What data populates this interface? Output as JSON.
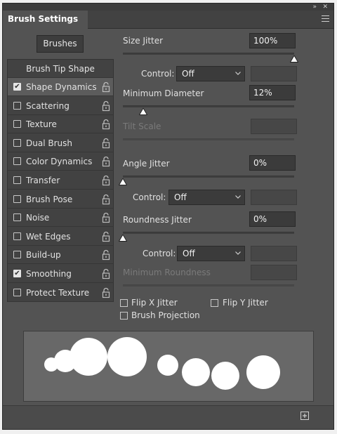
{
  "panel": {
    "title": "Brush Settings"
  },
  "icons": {
    "collapse": "double-chevron-icon",
    "close": "close-icon",
    "menu": "hamburger-menu-icon",
    "lock": "lock-icon",
    "dropdown": "chevron-down-icon",
    "slider_thumb": "triangle-thumb-icon",
    "new_preset": "new-brush-icon"
  },
  "brushes_button": "Brushes",
  "sidebar": {
    "header": "Brush Tip Shape",
    "items": [
      {
        "label": "Shape Dynamics",
        "checked": true,
        "selected": true
      },
      {
        "label": "Scattering",
        "checked": false
      },
      {
        "label": "Texture",
        "checked": false
      },
      {
        "label": "Dual Brush",
        "checked": false
      },
      {
        "label": "Color Dynamics",
        "checked": false
      },
      {
        "label": "Transfer",
        "checked": false
      },
      {
        "label": "Brush Pose",
        "checked": false
      },
      {
        "label": "Noise",
        "checked": false
      },
      {
        "label": "Wet Edges",
        "checked": false
      },
      {
        "label": "Build-up",
        "checked": false
      },
      {
        "label": "Smoothing",
        "checked": true
      },
      {
        "label": "Protect Texture",
        "checked": false
      }
    ]
  },
  "settings": {
    "size_jitter": {
      "label": "Size Jitter",
      "value": "100%",
      "level": 1.0
    },
    "control_1": {
      "label": "Control:",
      "value": "Off"
    },
    "min_diameter": {
      "label": "Minimum Diameter",
      "value": "12%",
      "level": 0.12
    },
    "tilt_scale": {
      "label": "Tilt Scale"
    },
    "angle_jitter": {
      "label": "Angle Jitter",
      "value": "0%",
      "level": 0.0
    },
    "control_2": {
      "label": "Control:",
      "value": "Off"
    },
    "roundness_jitter": {
      "label": "Roundness Jitter",
      "value": "0%",
      "level": 0.0
    },
    "control_3": {
      "label": "Control:",
      "value": "Off"
    },
    "min_roundness": {
      "label": "Minimum Roundness"
    },
    "flip_x": {
      "label": "Flip X Jitter",
      "checked": false
    },
    "flip_y": {
      "label": "Flip Y Jitter",
      "checked": false
    },
    "brush_projection": {
      "label": "Brush Projection",
      "checked": false
    }
  },
  "colors": {
    "panel_bg": "#535353",
    "sidebar_bg": "#424242",
    "field_bg": "#3b3b3b",
    "preview_bg": "#686868",
    "dab": "#ffffff"
  }
}
